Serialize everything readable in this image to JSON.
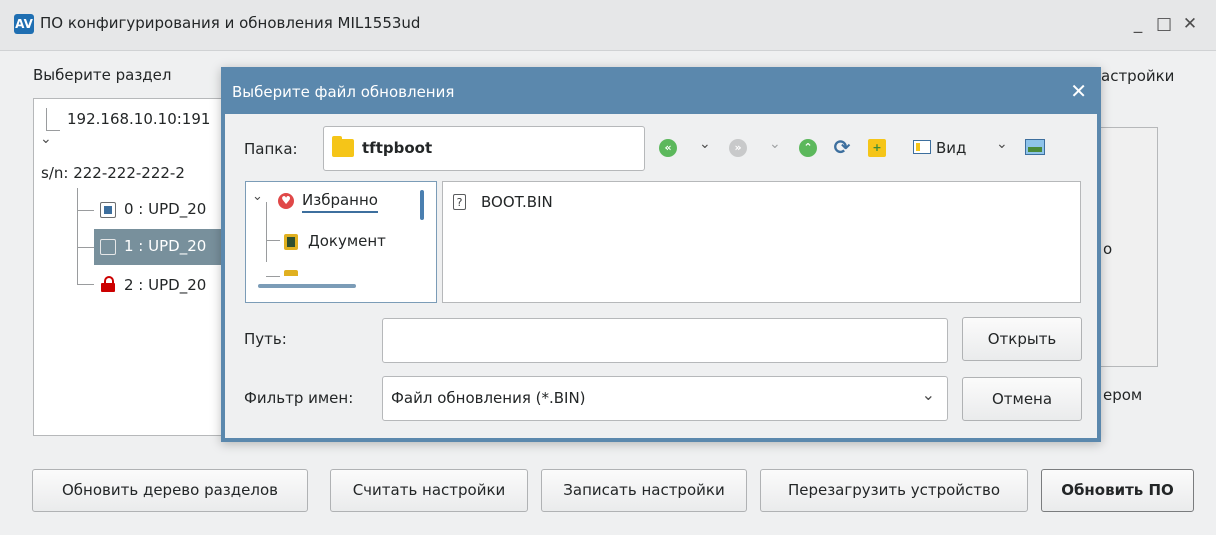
{
  "window": {
    "title": "ПО конфигурирования и обновления MIL1553ud",
    "app_icon_text": "AV",
    "minimize_glyph": "_",
    "maximize_glyph": "□",
    "close_glyph": "✕"
  },
  "main": {
    "section_label": "Выберите раздел",
    "tree": {
      "root": "192.168.10.10:191",
      "expand_glyph": "⌄",
      "serial": "s/n: 222-222-222-2",
      "items": [
        {
          "label": "0 : UPD_20"
        },
        {
          "label": "1 : UPD_20"
        },
        {
          "label": "2 : UPD_20"
        }
      ]
    },
    "right_fragments": {
      "settings": "астройки",
      "middle": "о",
      "bottom": "ером"
    }
  },
  "buttons": {
    "refresh_tree": "Обновить дерево разделов",
    "read_settings": "Считать настройки",
    "write_settings": "Записать настройки",
    "reboot": "Перезагрузить устройство",
    "update_fw": "Обновить ПО"
  },
  "dialog": {
    "title": "Выберите файл обновления",
    "close_glyph": "✕",
    "folder_label": "Папка:",
    "folder_value": "tftpboot",
    "toolbar": {
      "back_glyph": "«",
      "forward_glyph": "»",
      "up_glyph": "⌃",
      "reload_glyph": "⟳",
      "newfolder_glyph": "+",
      "view_label": "Вид",
      "chevron": "⌄"
    },
    "places": [
      {
        "label": "Избранно"
      },
      {
        "label": "Документ"
      }
    ],
    "files": [
      {
        "name": "BOOT.BIN",
        "icon_glyph": "?"
      }
    ],
    "path_label": "Путь:",
    "path_value": "",
    "open_button": "Открыть",
    "filter_label": "Фильтр имен:",
    "filter_value": "Файл обновления (*.BIN)",
    "cancel_button": "Отмена"
  },
  "colors": {
    "dialog_frame": "#5b88ad",
    "selection": "#78909c",
    "folder_yellow": "#f5c518",
    "nav_green": "#5cb85c",
    "lock_red": "#cc0000"
  }
}
